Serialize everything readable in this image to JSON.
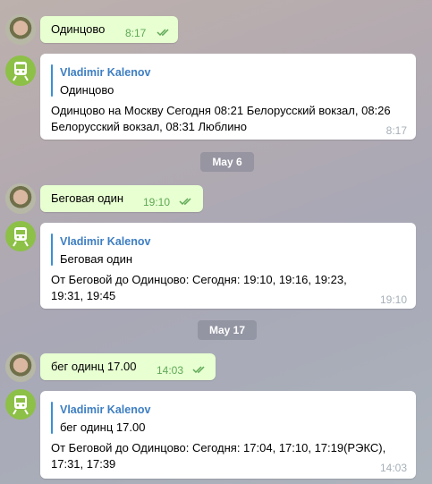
{
  "colors": {
    "outgoing_bubble": "#e7ffd1",
    "incoming_bubble": "#ffffff",
    "quote_accent": "#3a8fd6",
    "time_outgoing": "#5fa956",
    "bot_avatar": "#8dc047"
  },
  "messages": [
    {
      "text": "Одинцово",
      "time": "8:17"
    },
    {
      "quote_name": "Vladimir Kalenov",
      "quote_text": "Одинцово",
      "text": "Одинцово на Москву Сегодня 08:21 Белорусский вокзал, 08:26 Белорусский вокзал, 08:31 Люблино",
      "time": "8:17"
    },
    {
      "date": "May 6"
    },
    {
      "text": "Беговая один",
      "time": "19:10"
    },
    {
      "quote_name": "Vladimir Kalenov",
      "quote_text": "Беговая один",
      "text": "От Беговой до Одинцово: Сегодня: 19:10, 19:16, 19:23, 19:31, 19:45",
      "time": "19:10"
    },
    {
      "date": "May 17"
    },
    {
      "text": "бег одинц 17.00",
      "time": "14:03"
    },
    {
      "quote_name": "Vladimir Kalenov",
      "quote_text": "бег одинц 17.00",
      "text": "От Беговой до Одинцово: Сегодня: 17:04, 17:10, 17:19(РЭКС), 17:31, 17:39",
      "time": "14:03"
    }
  ]
}
